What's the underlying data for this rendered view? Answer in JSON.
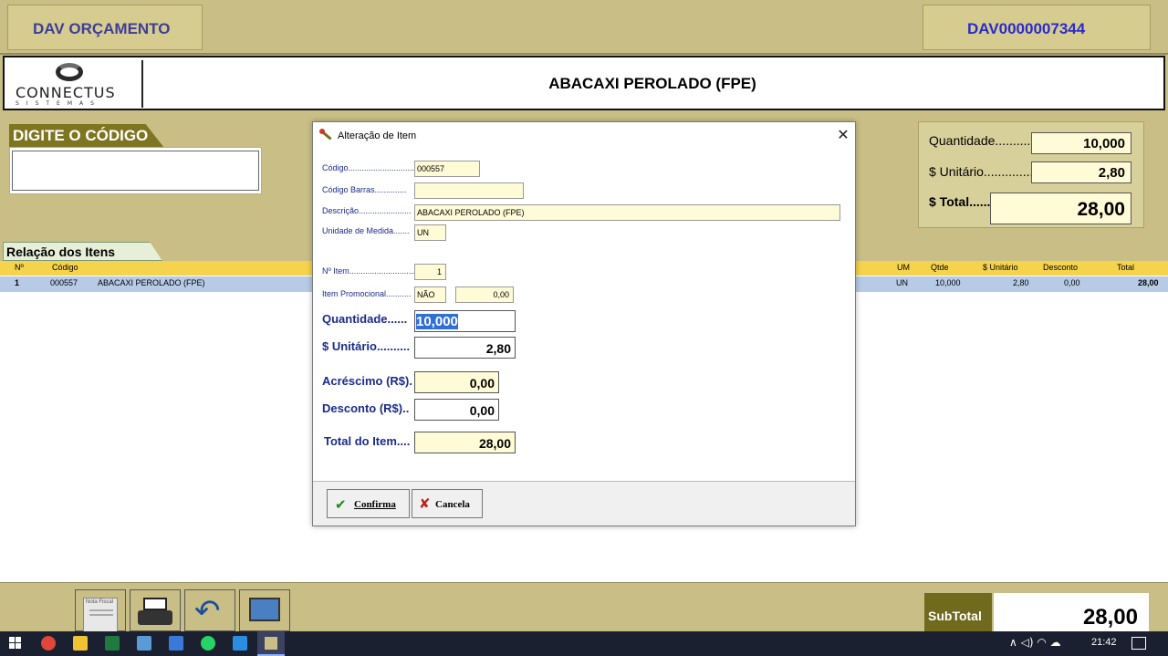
{
  "header": {
    "title": "DAV ORÇAMENTO",
    "document_number": "DAV0000007344"
  },
  "logo": {
    "line1": "CONNECTUS",
    "line2": "SISTEMAS"
  },
  "product": {
    "name": "ABACAXI PEROLADO (FPE)"
  },
  "code_entry": {
    "label": "DIGITE O CÓDIGO",
    "value": ""
  },
  "summary": {
    "quantidade_label": "Quantidade............",
    "quantidade_value": "10,000",
    "unitario_label": "$ Unitário...............",
    "unitario_value": "2,80",
    "total_label": "$ Total......",
    "total_value": "28,00"
  },
  "items": {
    "tab_label": "Relação dos Itens",
    "columns": [
      "Nº",
      "Código",
      "UM",
      "Qtde",
      "$ Unitário",
      "Desconto",
      "Total"
    ],
    "rows": [
      {
        "n": "1",
        "codigo": "000557",
        "descricao": "ABACAXI PEROLADO (FPE)",
        "um": "UN",
        "qtde": "10,000",
        "unitario": "2,80",
        "desconto": "0,00",
        "total": "28,00"
      }
    ]
  },
  "footer": {
    "subtotal_label": "SubTotal",
    "subtotal_value": "28,00",
    "nota_fiscal_label": "Nota Fiscal"
  },
  "dialog": {
    "title": "Alteração de Item",
    "codigo_label": "Código.............................",
    "codigo_value": "000557",
    "codigo_barras_label": "Código Barras..............",
    "codigo_barras_value": "",
    "descricao_label": "Descrição.......................",
    "descricao_value": "ABACAXI PEROLADO (FPE)",
    "unidade_label": "Unidade de Medida.......",
    "unidade_value": "UN",
    "n_item_label": "Nº Item.............................",
    "n_item_value": "1",
    "promocional_label": "Item Promocional...........",
    "promocional_value": "NÃO",
    "promocional_price": "0,00",
    "quantidade_label": "Quantidade......",
    "quantidade_value": "10,000",
    "unitario_label": "$ Unitário..........",
    "unitario_value": "2,80",
    "acrescimo_label": "Acréscimo (R$).",
    "acrescimo_value": "0,00",
    "desconto_label": "Desconto (R$)..",
    "desconto_value": "0,00",
    "total_item_label": "Total do Item....",
    "total_item_value": "28,00",
    "confirm_label": "Confirma",
    "cancel_label": "Cancela"
  },
  "taskbar": {
    "clock": "21:42"
  }
}
